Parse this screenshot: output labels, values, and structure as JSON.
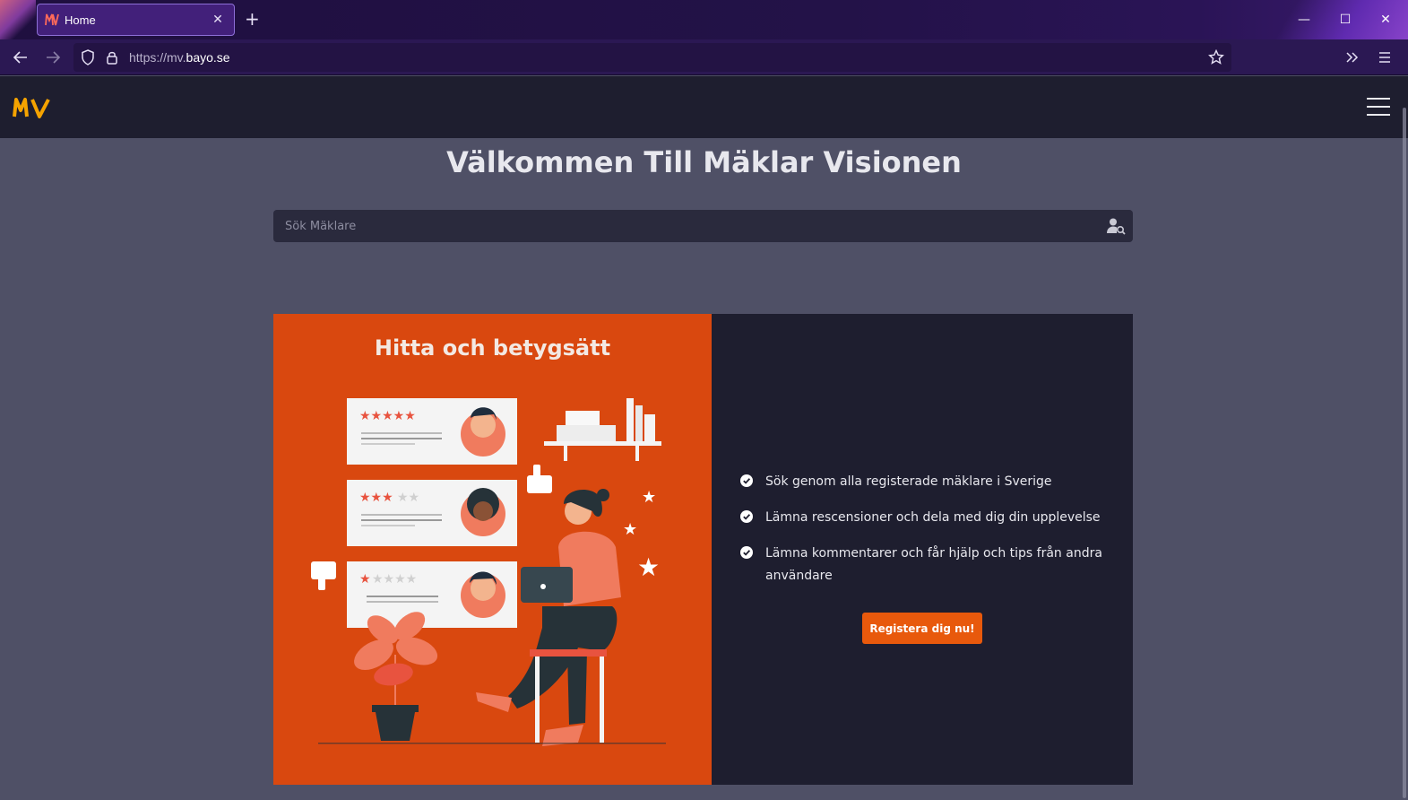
{
  "browser": {
    "tab_title": "Home",
    "url_prefix": "https://mv.",
    "url_domain": "bayo.se",
    "new_tab_symbol": "+",
    "tab_close_symbol": "✕",
    "window_controls": {
      "minimize": "—",
      "maximize": "☐",
      "close": "✕"
    }
  },
  "site": {
    "title": "Välkommen Till Mäklar Visionen",
    "search": {
      "placeholder": "Sök Mäklare",
      "value": ""
    },
    "card": {
      "heading": "Hitta och betygsätt",
      "features": [
        "Sök genom alla registerade mäklare i Sverige",
        "Lämna rescensioner och dela med dig din upplevelse",
        "Lämna kommentarer och får hjälp och tips från andra användare"
      ],
      "cta_label": "Registera dig nu!"
    }
  },
  "colors": {
    "logo": "#f5a300",
    "accent_orange": "#d9480f",
    "button_orange": "#e8590c",
    "dark_panel": "#1e1e2f",
    "page_bg": "#4f5066"
  },
  "icons": [
    "back-icon",
    "forward-icon",
    "shield-icon",
    "lock-icon",
    "star-bookmark-icon",
    "overflow-icon",
    "menu-icon",
    "user-search-icon",
    "check-circle-icon",
    "hamburger-icon"
  ]
}
